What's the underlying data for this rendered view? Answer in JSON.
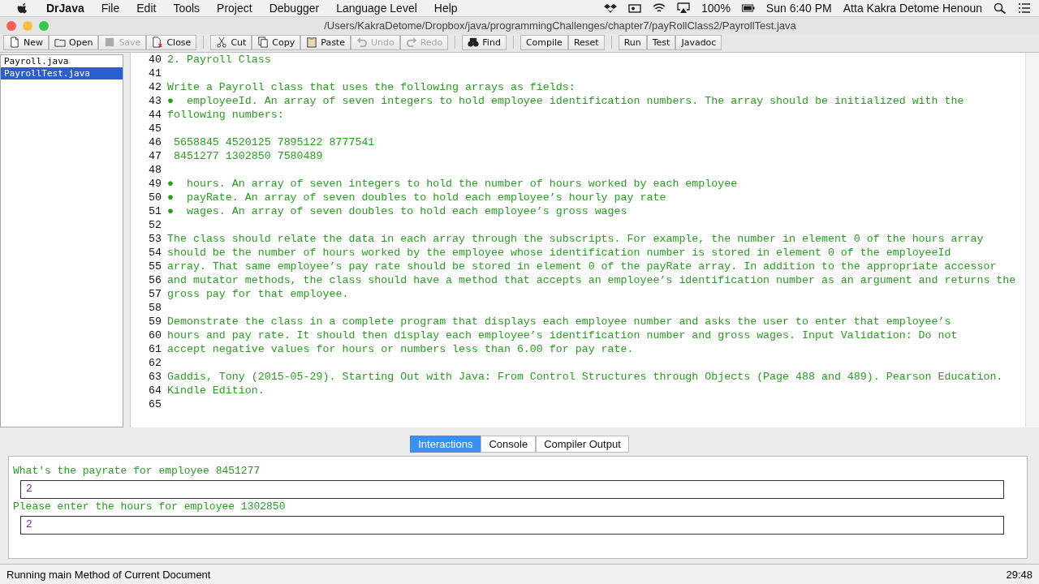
{
  "menu_bar": {
    "app": "DrJava",
    "items": [
      "File",
      "Edit",
      "Tools",
      "Project",
      "Debugger",
      "Language Level",
      "Help"
    ],
    "battery": "100%",
    "clock": "Sun 6:40 PM",
    "user": "Atta Kakra Detome Henoun"
  },
  "window": {
    "title": "/Users/KakraDetome/Dropbox/java/programmingChallenges/chapter7/payRollClass2/PayrollTest.java"
  },
  "toolbar": [
    [
      {
        "label": "New",
        "disabled": false
      },
      {
        "label": "Open",
        "disabled": false
      },
      {
        "label": "Save",
        "disabled": true
      },
      {
        "label": "Close",
        "disabled": false
      }
    ],
    [
      {
        "label": "Cut",
        "disabled": false
      },
      {
        "label": "Copy",
        "disabled": false
      },
      {
        "label": "Paste",
        "disabled": false
      },
      {
        "label": "Undo",
        "disabled": true
      },
      {
        "label": "Redo",
        "disabled": true
      }
    ],
    [
      {
        "label": "Find",
        "disabled": false
      }
    ],
    [
      {
        "label": "Compile",
        "disabled": false
      },
      {
        "label": "Reset",
        "disabled": false
      }
    ],
    [
      {
        "label": "Run",
        "disabled": false
      },
      {
        "label": "Test",
        "disabled": false
      },
      {
        "label": "Javadoc",
        "disabled": false
      }
    ]
  ],
  "files": [
    {
      "name": "Payroll.java",
      "selected": false
    },
    {
      "name": "PayrollTest.java",
      "selected": true
    }
  ],
  "editor": {
    "lines": [
      {
        "number": "40",
        "text": "2. Payroll Class"
      },
      {
        "number": "41"
      },
      {
        "number": "42",
        "text": "Write a Payroll class that uses the following arrays as fields:"
      },
      {
        "number": "43",
        "text": "●  employeeId. An array of seven integers to hold employee identification numbers. The array should be initialized with the"
      },
      {
        "number": "44",
        "text": "following numbers:"
      },
      {
        "number": "45"
      },
      {
        "number": "46",
        "text": " 5658845 4520125 7895122 8777541"
      },
      {
        "number": "47",
        "text": " 8451277 1302850 7580489"
      },
      {
        "number": "48"
      },
      {
        "number": "49",
        "text": "●  hours. An array of seven integers to hold the number of hours worked by each employee"
      },
      {
        "number": "50",
        "text": "●  payRate. An array of seven doubles to hold each employee’s hourly pay rate"
      },
      {
        "number": "51",
        "text": "●  wages. An array of seven doubles to hold each employee’s gross wages"
      },
      {
        "number": "52"
      },
      {
        "number": "53",
        "text": "The class should relate the data in each array through the subscripts. For example, the number in element 0 of the hours array"
      },
      {
        "number": "54",
        "text": "should be the number of hours worked by the employee whose identification number is stored in element 0 of the employeeId"
      },
      {
        "number": "55",
        "text": "array. That same employee’s pay rate should be stored in element 0 of the payRate array. In addition to the appropriate accessor"
      },
      {
        "number": "56",
        "text": "and mutator methods, the class should have a method that accepts an employee’s identification number as an argument and returns the"
      },
      {
        "number": "57",
        "text": "gross pay for that employee."
      },
      {
        "number": "58"
      },
      {
        "number": "59",
        "text": "Demonstrate the class in a complete program that displays each employee number and asks the user to enter that employee’s"
      },
      {
        "number": "60",
        "text": "hours and pay rate. It should then display each employee’s identification number and gross wages. Input Validation: Do not"
      },
      {
        "number": "61",
        "text": "accept negative values for hours or numbers less than 6.00 for pay rate."
      },
      {
        "number": "62"
      },
      {
        "number": "63",
        "text": "Gaddis, Tony (2015-05-29). Starting Out with Java: From Control Structures through Objects (Page 488 and 489). Pearson Education."
      },
      {
        "number": "64",
        "text": "Kindle Edition."
      },
      {
        "number": "65"
      }
    ]
  },
  "tabs": [
    {
      "label": "Interactions",
      "selected": true
    },
    {
      "label": "Console",
      "selected": false
    },
    {
      "label": "Compiler Output",
      "selected": false
    }
  ],
  "interactions": [
    {
      "kind": "output",
      "text": "What's the payrate for employee 8451277"
    },
    {
      "kind": "input",
      "text": "2"
    },
    {
      "kind": "output",
      "text": "Please enter the hours for employee 1302850"
    },
    {
      "kind": "input",
      "text": "2"
    }
  ],
  "status_bar": {
    "message": "Running main Method of Current Document",
    "position": "29:48"
  }
}
